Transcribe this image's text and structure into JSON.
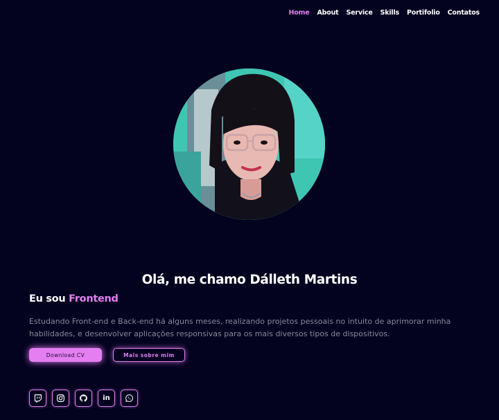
{
  "nav": {
    "items": [
      {
        "label": "Home",
        "active": true
      },
      {
        "label": "About"
      },
      {
        "label": "Service"
      },
      {
        "label": "Skills"
      },
      {
        "label": "Portifolio"
      },
      {
        "label": "Contatos"
      }
    ]
  },
  "hero": {
    "greeting": "Olá, me chamo Dálleth Martins",
    "role_prefix": "Eu sou",
    "role_highlight": "Frontend",
    "description": "Estudando Front-end e Back-end há alguns meses, realizando projetos pessoais no intuito de aprimorar minha habilidades, e desenvolver aplicações responsivas para os mais diversos tipos de dispositivos.",
    "download_label": "Download CV",
    "more_label": "Mais sobre mim"
  },
  "socials": [
    {
      "icon": "twitch-icon"
    },
    {
      "icon": "instagram-icon"
    },
    {
      "icon": "github-icon"
    },
    {
      "icon": "linkedin-icon",
      "text": "in"
    },
    {
      "icon": "whatsapp-icon"
    }
  ],
  "colors": {
    "background": "#03021f",
    "accent": "#e57ef0",
    "muted_text": "#8b8a9c"
  }
}
